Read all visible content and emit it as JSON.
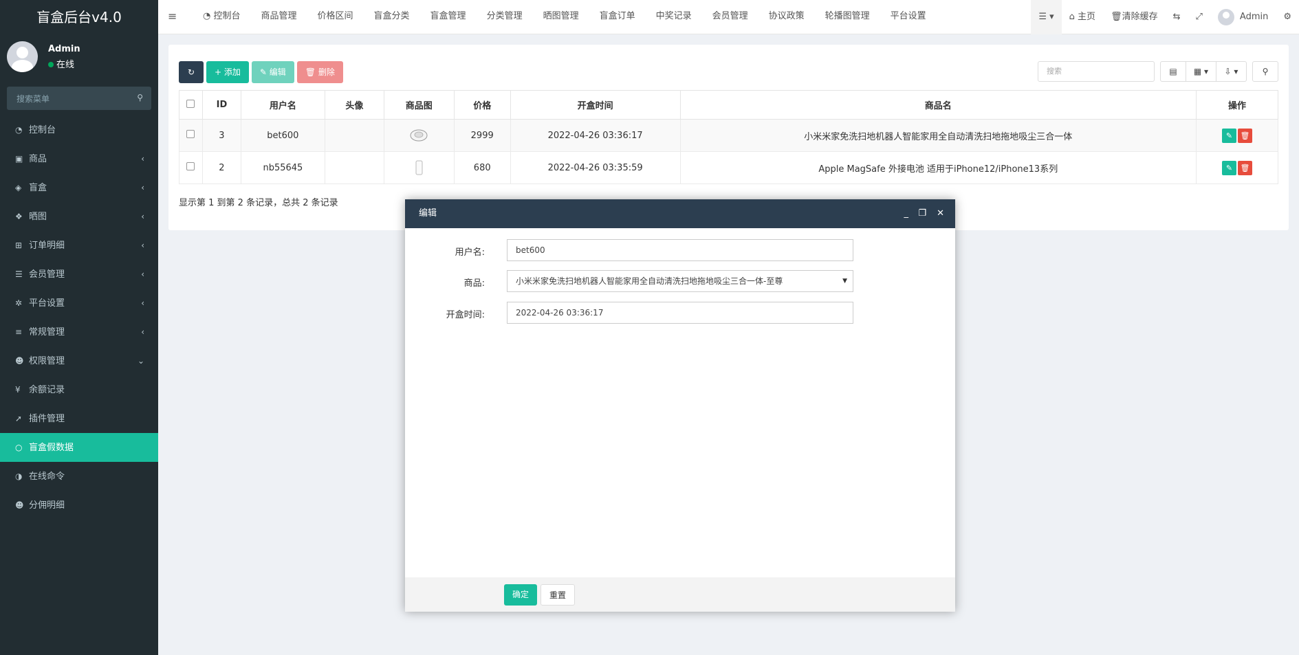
{
  "app": {
    "title": "盲盒后台v4.0"
  },
  "user": {
    "name": "Admin",
    "status": "在线"
  },
  "sidebar": {
    "search_placeholder": "搜索菜单",
    "items": [
      {
        "label": "控制台",
        "icon": "dashboard-icon",
        "arrow": ""
      },
      {
        "label": "商品",
        "icon": "shopping-bag-icon",
        "arrow": "‹"
      },
      {
        "label": "盲盒",
        "icon": "cube-icon",
        "arrow": "‹"
      },
      {
        "label": "晒图",
        "icon": "gem-icon",
        "arrow": "‹"
      },
      {
        "label": "订单明细",
        "icon": "cart-icon",
        "arrow": "‹"
      },
      {
        "label": "会员管理",
        "icon": "list-icon",
        "arrow": "‹"
      },
      {
        "label": "平台设置",
        "icon": "gear-icon",
        "arrow": "‹"
      },
      {
        "label": "常规管理",
        "icon": "database-icon",
        "arrow": "‹"
      },
      {
        "label": "权限管理",
        "icon": "users-icon",
        "arrow": "⌄"
      },
      {
        "label": "余额记录",
        "icon": "yen-icon",
        "arrow": ""
      },
      {
        "label": "插件管理",
        "icon": "rocket-icon",
        "arrow": ""
      },
      {
        "label": "盲盒假数据",
        "icon": "circle-icon",
        "arrow": ""
      },
      {
        "label": "在线命令",
        "icon": "contrast-icon",
        "arrow": ""
      },
      {
        "label": "分佣明细",
        "icon": "users-icon",
        "arrow": ""
      }
    ]
  },
  "navbar": {
    "items": [
      "控制台",
      "商品管理",
      "价格区间",
      "盲盒分类",
      "盲盒管理",
      "分类管理",
      "晒图管理",
      "盲盒订单",
      "中奖记录",
      "会员管理",
      "协议政策",
      "轮播图管理",
      "平台设置"
    ],
    "home": "主页",
    "clear_cache": "清除缓存",
    "admin": "Admin"
  },
  "toolbar": {
    "add": "添加",
    "edit": "编辑",
    "delete": "删除",
    "search_placeholder": "搜索"
  },
  "table": {
    "headers": [
      "ID",
      "用户名",
      "头像",
      "商品图",
      "价格",
      "开盒时间",
      "商品名",
      "操作"
    ],
    "rows": [
      {
        "id": "3",
        "username": "bet600",
        "avatar": "",
        "price": "2999",
        "time": "2022-04-26 03:36:17",
        "product": "小米米家免洗扫地机器人智能家用全自动清洗扫地拖地吸尘三合一体"
      },
      {
        "id": "2",
        "username": "nb55645",
        "avatar": "",
        "price": "680",
        "time": "2022-04-26 03:35:59",
        "product": "Apple MagSafe 外接电池 适用于iPhone12/iPhone13系列"
      }
    ],
    "summary": "显示第 1 到第 2 条记录，总共 2 条记录"
  },
  "modal": {
    "title": "编辑",
    "fields": {
      "username_label": "用户名:",
      "username_value": "bet600",
      "product_label": "商品:",
      "product_value": "小米米家免洗扫地机器人智能家用全自动清洗扫地拖地吸尘三合一体-至尊",
      "time_label": "开盒时间:",
      "time_value": "2022-04-26 03:36:17"
    },
    "ok": "确定",
    "reset": "重置"
  },
  "colors": {
    "sidebar": "#222d32",
    "accent": "#18bc9c",
    "header_dark": "#2c3e50",
    "danger": "#e74c3c"
  }
}
